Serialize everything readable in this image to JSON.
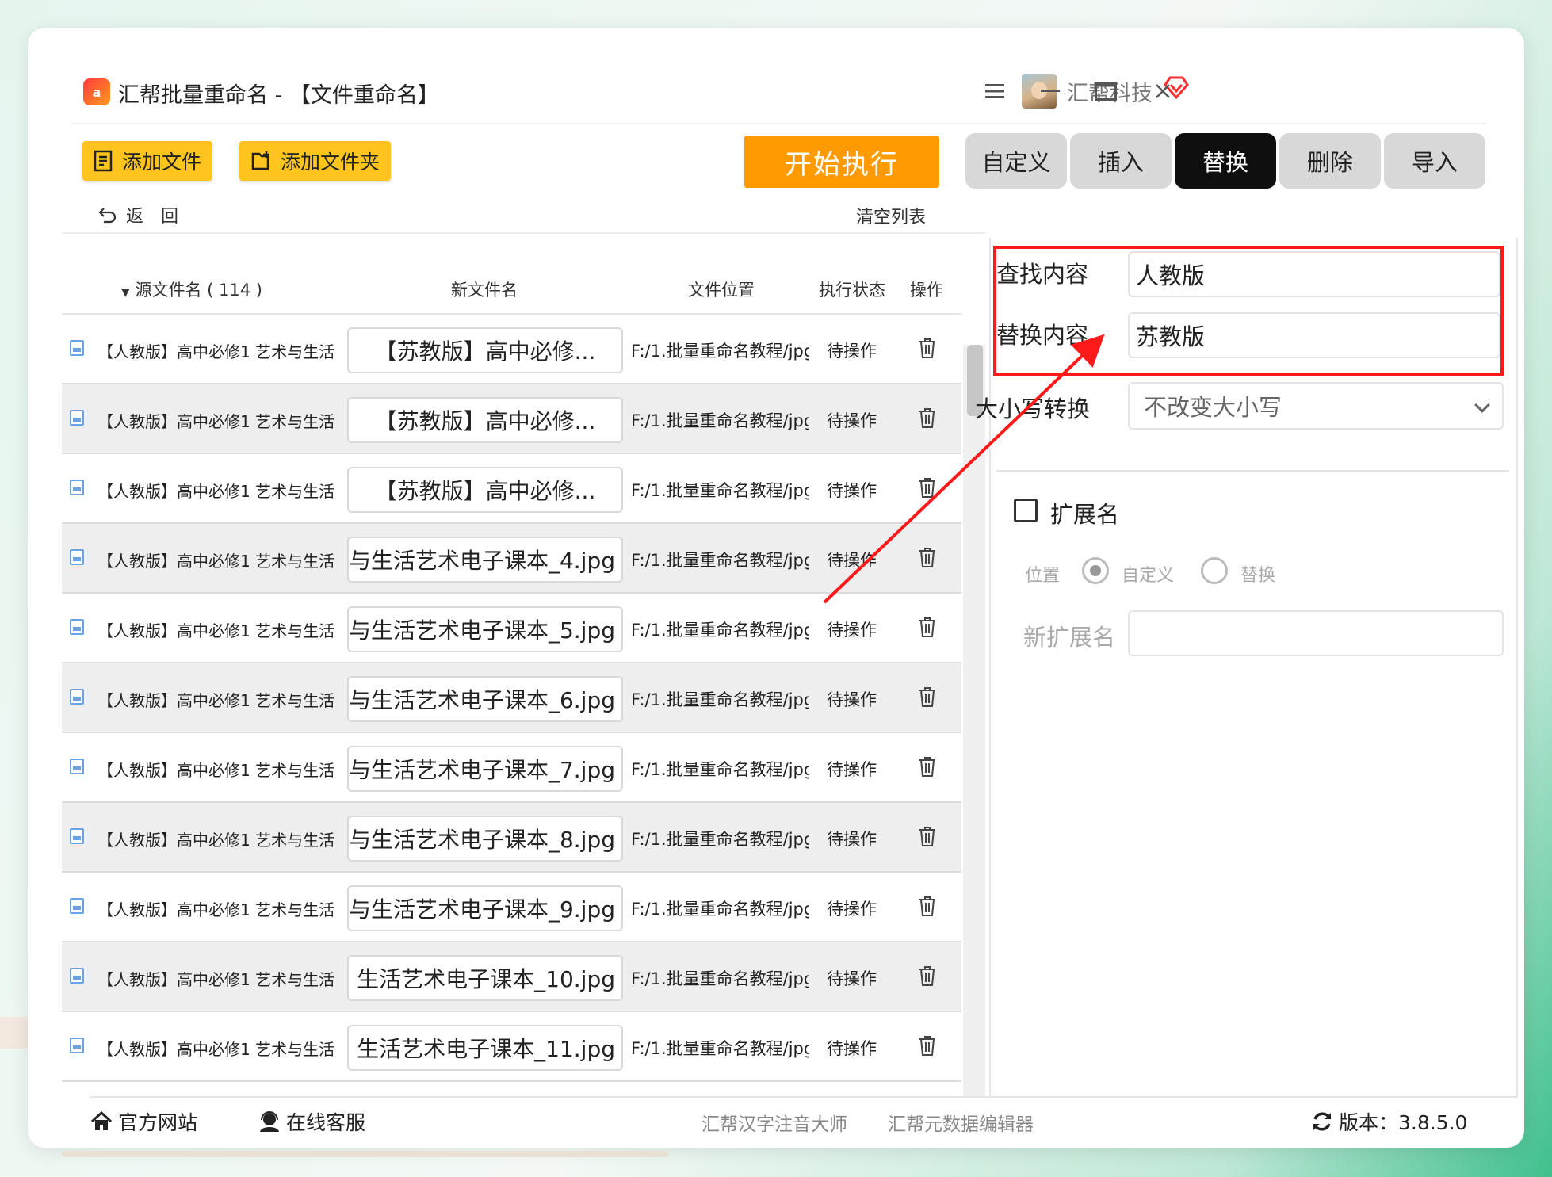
{
  "app": {
    "title": "汇帮批量重命名 - 【文件重命名】",
    "logo_text": "a",
    "company": "汇帮科技"
  },
  "window_controls": [
    "menu-icon",
    "minimize-icon",
    "maximize-icon",
    "close-icon"
  ],
  "toolbar": {
    "add_file": "添加文件",
    "add_folder": "添加文件夹",
    "start": "开始执行",
    "tabs": [
      {
        "label": "自定义",
        "active": false
      },
      {
        "label": "插入",
        "active": false
      },
      {
        "label": "替换",
        "active": true
      },
      {
        "label": "删除",
        "active": false
      },
      {
        "label": "导入",
        "active": false
      }
    ]
  },
  "list": {
    "back_label": "返　回",
    "clear_label": "清空列表",
    "columns": {
      "source": "源文件名 ( 114 )",
      "new_name": "新文件名",
      "location": "文件位置",
      "status": "执行状态",
      "action": "操作"
    },
    "rows": [
      {
        "source": "【人教版】高中必修1 艺术与生活",
        "new_name": "【苏教版】高中必修...",
        "location": "F:/1.批量重命名教程/jpg",
        "status": "待操作"
      },
      {
        "source": "【人教版】高中必修1 艺术与生活",
        "new_name": "【苏教版】高中必修...",
        "location": "F:/1.批量重命名教程/jpg",
        "status": "待操作"
      },
      {
        "source": "【人教版】高中必修1 艺术与生活",
        "new_name": "【苏教版】高中必修...",
        "location": "F:/1.批量重命名教程/jpg",
        "status": "待操作"
      },
      {
        "source": "【人教版】高中必修1 艺术与生活",
        "new_name": "与生活艺术电子课本_4.jpg",
        "location": "F:/1.批量重命名教程/jpg",
        "status": "待操作"
      },
      {
        "source": "【人教版】高中必修1 艺术与生活",
        "new_name": "与生活艺术电子课本_5.jpg",
        "location": "F:/1.批量重命名教程/jpg",
        "status": "待操作"
      },
      {
        "source": "【人教版】高中必修1 艺术与生活",
        "new_name": "与生活艺术电子课本_6.jpg",
        "location": "F:/1.批量重命名教程/jpg",
        "status": "待操作"
      },
      {
        "source": "【人教版】高中必修1 艺术与生活",
        "new_name": "与生活艺术电子课本_7.jpg",
        "location": "F:/1.批量重命名教程/jpg",
        "status": "待操作"
      },
      {
        "source": "【人教版】高中必修1 艺术与生活",
        "new_name": "与生活艺术电子课本_8.jpg",
        "location": "F:/1.批量重命名教程/jpg",
        "status": "待操作"
      },
      {
        "source": "【人教版】高中必修1 艺术与生活",
        "new_name": "与生活艺术电子课本_9.jpg",
        "location": "F:/1.批量重命名教程/jpg",
        "status": "待操作"
      },
      {
        "source": "【人教版】高中必修1 艺术与生活",
        "new_name": "生活艺术电子课本_10.jpg",
        "location": "F:/1.批量重命名教程/jpg",
        "status": "待操作"
      },
      {
        "source": "【人教版】高中必修1 艺术与生活",
        "new_name": "生活艺术电子课本_11.jpg",
        "location": "F:/1.批量重命名教程/jpg",
        "status": "待操作"
      }
    ]
  },
  "panel": {
    "find_label": "查找内容",
    "find_value": "人教版",
    "replace_label": "替换内容",
    "replace_value": "苏教版",
    "case_label": "大小写转换",
    "case_value": "不改变大小写",
    "ext_label": "扩展名",
    "ext_checked": false,
    "position_label": "位置",
    "position_options": [
      {
        "label": "自定义",
        "checked": true
      },
      {
        "label": "替换",
        "checked": false
      }
    ],
    "new_ext_label": "新扩展名",
    "new_ext_value": ""
  },
  "footer": {
    "website": "官方网站",
    "support": "在线客服",
    "link1": "汇帮汉字注音大师",
    "link2": "汇帮元数据编辑器",
    "version": "版本：3.8.5.0"
  },
  "colors": {
    "accent_orange": "#ff9a00",
    "button_yellow": "#ffc51e",
    "highlight_red": "#ff1a1a",
    "active_tab": "#0f0f0f"
  }
}
